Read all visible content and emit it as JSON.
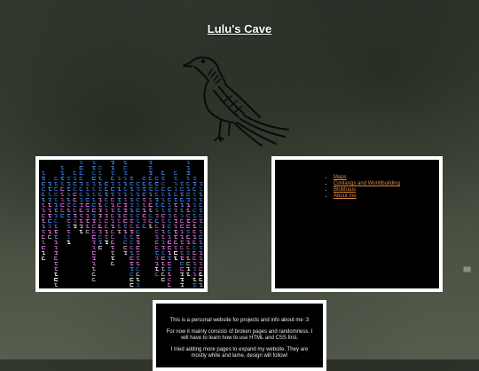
{
  "header": {
    "title": "Lulu's Cave"
  },
  "nav": {
    "items": [
      {
        "label": "Maps"
      },
      {
        "label": "Conlangs and Worldbuilding"
      },
      {
        "label": "Blobhaus"
      },
      {
        "label": "About me"
      }
    ]
  },
  "intro": {
    "p1": "This is a personal website for projects and info about me :3",
    "p2": "For now it mainly consists of broken pages and randomness. I will have to learn how to use HTML and CSS first.",
    "p3": "I tried adding more pages to expand my website. They are mostly white and lame, design will follow!"
  },
  "colors": {
    "link": "#d88a3c",
    "panel_bg": "#000000",
    "panel_border": "#ffffff",
    "matrix_blue": "#3a7fe6",
    "matrix_pink": "#e070e6",
    "matrix_white": "#ffffff"
  },
  "icons": {
    "crow": "crow-icon",
    "scroll": "scroll-button-icon"
  }
}
